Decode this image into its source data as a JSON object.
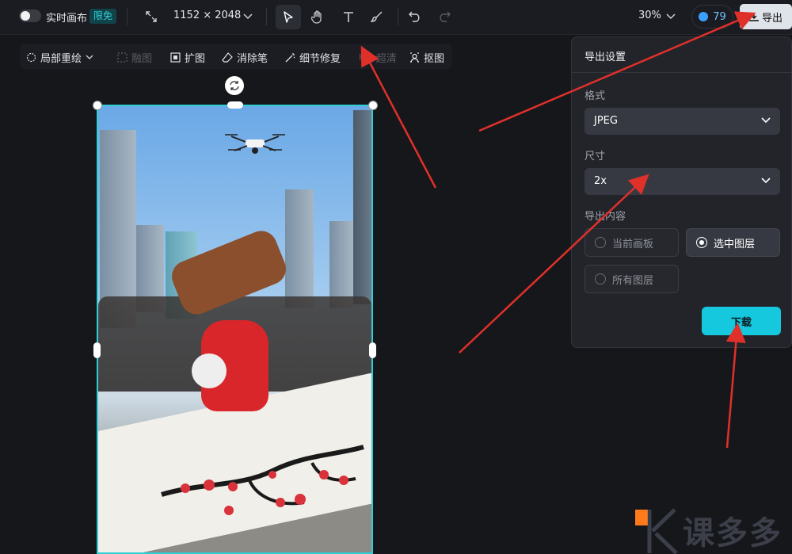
{
  "topbar": {
    "realtime_label": "实时画布",
    "limited_badge": "限免",
    "canvas_size": "1152 × 2048",
    "zoom": "30%",
    "credits": "79",
    "export_label": "导出"
  },
  "subtoolbar": {
    "items": [
      {
        "label": "局部重绘",
        "enabled": true
      },
      {
        "label": "融图",
        "enabled": false
      },
      {
        "label": "扩图",
        "enabled": true
      },
      {
        "label": "消除笔",
        "enabled": true
      },
      {
        "label": "细节修复",
        "enabled": true
      },
      {
        "label": "超清",
        "enabled": false
      },
      {
        "label": "抠图",
        "enabled": true
      }
    ]
  },
  "export_panel": {
    "title": "导出设置",
    "format_label": "格式",
    "format_value": "JPEG",
    "size_label": "尺寸",
    "size_value": "2x",
    "content_label": "导出内容",
    "options": [
      {
        "label": "当前画板",
        "selected": false
      },
      {
        "label": "选中图层",
        "selected": true
      },
      {
        "label": "所有图层",
        "selected": false
      }
    ],
    "download_label": "下载"
  },
  "colors": {
    "accent": "#15c8de",
    "selection_border": "#2ecfd6",
    "annotation_arrow": "#e0302a",
    "background": "#16171b"
  }
}
